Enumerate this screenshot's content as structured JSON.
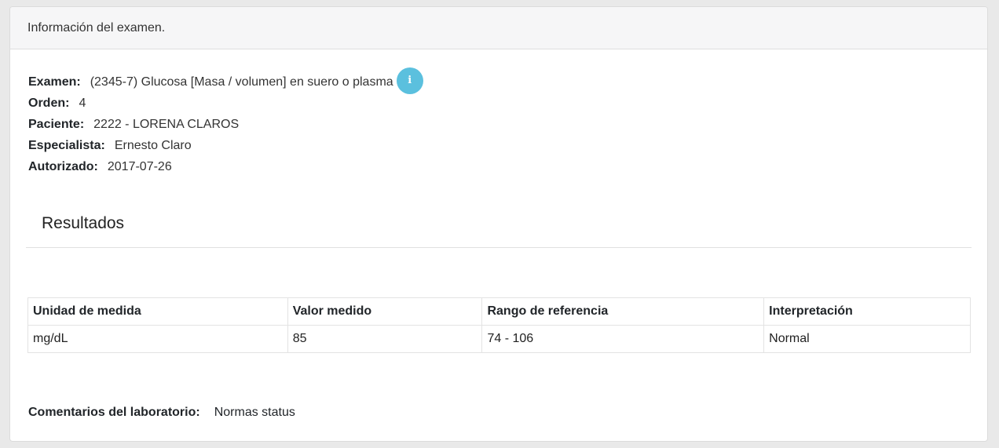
{
  "header": {
    "title": "Información del examen."
  },
  "exam": {
    "fields": [
      {
        "label": "Examen:",
        "value": "(2345-7) Glucosa [Masa / volumen] en suero o plasma"
      },
      {
        "label": "Orden:",
        "value": "4"
      },
      {
        "label": "Paciente:",
        "value": "2222 - LORENA CLAROS"
      },
      {
        "label": "Especialista:",
        "value": "Ernesto Claro"
      },
      {
        "label": "Autorizado:",
        "value": "2017-07-26"
      }
    ],
    "info_icon": "info-icon",
    "info_icon_color": "#5bc0de"
  },
  "results": {
    "title": "Resultados",
    "columns": [
      "Unidad de medida",
      "Valor medido",
      "Rango de referencia",
      "Interpretación"
    ],
    "rows": [
      [
        "mg/dL",
        "85",
        "74 - 106",
        "Normal"
      ]
    ]
  },
  "comments": {
    "label": "Comentarios del laboratorio:",
    "value": "Normas status"
  }
}
